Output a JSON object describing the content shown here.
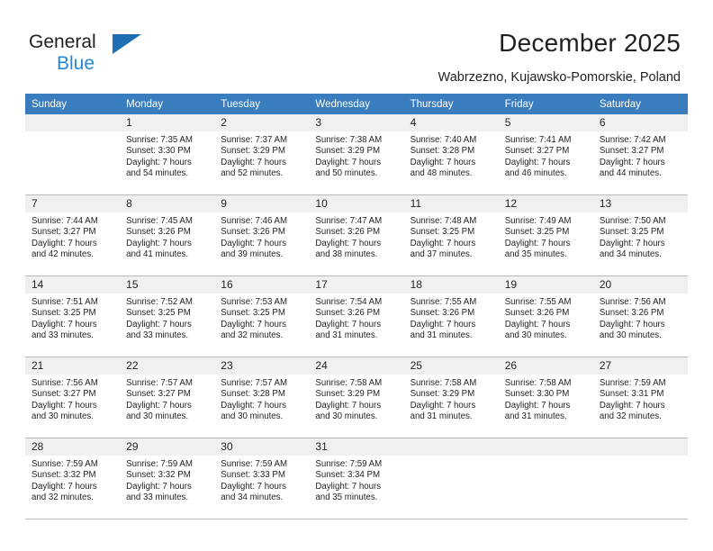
{
  "brand": {
    "name_part1": "General",
    "name_part2": "Blue",
    "triangle_color": "#1f6fb2",
    "blue_color": "#2389d4"
  },
  "header": {
    "title": "December 2025",
    "subtitle": "Wabrzezno, Kujawsko-Pomorskie, Poland"
  },
  "theme": {
    "header_row_bg": "#3a7dbe",
    "daynum_bg": "#f0f0f0",
    "border_color": "#b9b9b9",
    "text_color": "#231f20"
  },
  "weekdays": [
    "Sunday",
    "Monday",
    "Tuesday",
    "Wednesday",
    "Thursday",
    "Friday",
    "Saturday"
  ],
  "weeks": [
    [
      {
        "day": "",
        "lines": []
      },
      {
        "day": "1",
        "lines": [
          "Sunrise: 7:35 AM",
          "Sunset: 3:30 PM",
          "Daylight: 7 hours",
          "and 54 minutes."
        ]
      },
      {
        "day": "2",
        "lines": [
          "Sunrise: 7:37 AM",
          "Sunset: 3:29 PM",
          "Daylight: 7 hours",
          "and 52 minutes."
        ]
      },
      {
        "day": "3",
        "lines": [
          "Sunrise: 7:38 AM",
          "Sunset: 3:29 PM",
          "Daylight: 7 hours",
          "and 50 minutes."
        ]
      },
      {
        "day": "4",
        "lines": [
          "Sunrise: 7:40 AM",
          "Sunset: 3:28 PM",
          "Daylight: 7 hours",
          "and 48 minutes."
        ]
      },
      {
        "day": "5",
        "lines": [
          "Sunrise: 7:41 AM",
          "Sunset: 3:27 PM",
          "Daylight: 7 hours",
          "and 46 minutes."
        ]
      },
      {
        "day": "6",
        "lines": [
          "Sunrise: 7:42 AM",
          "Sunset: 3:27 PM",
          "Daylight: 7 hours",
          "and 44 minutes."
        ]
      }
    ],
    [
      {
        "day": "7",
        "lines": [
          "Sunrise: 7:44 AM",
          "Sunset: 3:27 PM",
          "Daylight: 7 hours",
          "and 42 minutes."
        ]
      },
      {
        "day": "8",
        "lines": [
          "Sunrise: 7:45 AM",
          "Sunset: 3:26 PM",
          "Daylight: 7 hours",
          "and 41 minutes."
        ]
      },
      {
        "day": "9",
        "lines": [
          "Sunrise: 7:46 AM",
          "Sunset: 3:26 PM",
          "Daylight: 7 hours",
          "and 39 minutes."
        ]
      },
      {
        "day": "10",
        "lines": [
          "Sunrise: 7:47 AM",
          "Sunset: 3:26 PM",
          "Daylight: 7 hours",
          "and 38 minutes."
        ]
      },
      {
        "day": "11",
        "lines": [
          "Sunrise: 7:48 AM",
          "Sunset: 3:25 PM",
          "Daylight: 7 hours",
          "and 37 minutes."
        ]
      },
      {
        "day": "12",
        "lines": [
          "Sunrise: 7:49 AM",
          "Sunset: 3:25 PM",
          "Daylight: 7 hours",
          "and 35 minutes."
        ]
      },
      {
        "day": "13",
        "lines": [
          "Sunrise: 7:50 AM",
          "Sunset: 3:25 PM",
          "Daylight: 7 hours",
          "and 34 minutes."
        ]
      }
    ],
    [
      {
        "day": "14",
        "lines": [
          "Sunrise: 7:51 AM",
          "Sunset: 3:25 PM",
          "Daylight: 7 hours",
          "and 33 minutes."
        ]
      },
      {
        "day": "15",
        "lines": [
          "Sunrise: 7:52 AM",
          "Sunset: 3:25 PM",
          "Daylight: 7 hours",
          "and 33 minutes."
        ]
      },
      {
        "day": "16",
        "lines": [
          "Sunrise: 7:53 AM",
          "Sunset: 3:25 PM",
          "Daylight: 7 hours",
          "and 32 minutes."
        ]
      },
      {
        "day": "17",
        "lines": [
          "Sunrise: 7:54 AM",
          "Sunset: 3:26 PM",
          "Daylight: 7 hours",
          "and 31 minutes."
        ]
      },
      {
        "day": "18",
        "lines": [
          "Sunrise: 7:55 AM",
          "Sunset: 3:26 PM",
          "Daylight: 7 hours",
          "and 31 minutes."
        ]
      },
      {
        "day": "19",
        "lines": [
          "Sunrise: 7:55 AM",
          "Sunset: 3:26 PM",
          "Daylight: 7 hours",
          "and 30 minutes."
        ]
      },
      {
        "day": "20",
        "lines": [
          "Sunrise: 7:56 AM",
          "Sunset: 3:26 PM",
          "Daylight: 7 hours",
          "and 30 minutes."
        ]
      }
    ],
    [
      {
        "day": "21",
        "lines": [
          "Sunrise: 7:56 AM",
          "Sunset: 3:27 PM",
          "Daylight: 7 hours",
          "and 30 minutes."
        ]
      },
      {
        "day": "22",
        "lines": [
          "Sunrise: 7:57 AM",
          "Sunset: 3:27 PM",
          "Daylight: 7 hours",
          "and 30 minutes."
        ]
      },
      {
        "day": "23",
        "lines": [
          "Sunrise: 7:57 AM",
          "Sunset: 3:28 PM",
          "Daylight: 7 hours",
          "and 30 minutes."
        ]
      },
      {
        "day": "24",
        "lines": [
          "Sunrise: 7:58 AM",
          "Sunset: 3:29 PM",
          "Daylight: 7 hours",
          "and 30 minutes."
        ]
      },
      {
        "day": "25",
        "lines": [
          "Sunrise: 7:58 AM",
          "Sunset: 3:29 PM",
          "Daylight: 7 hours",
          "and 31 minutes."
        ]
      },
      {
        "day": "26",
        "lines": [
          "Sunrise: 7:58 AM",
          "Sunset: 3:30 PM",
          "Daylight: 7 hours",
          "and 31 minutes."
        ]
      },
      {
        "day": "27",
        "lines": [
          "Sunrise: 7:59 AM",
          "Sunset: 3:31 PM",
          "Daylight: 7 hours",
          "and 32 minutes."
        ]
      }
    ],
    [
      {
        "day": "28",
        "lines": [
          "Sunrise: 7:59 AM",
          "Sunset: 3:32 PM",
          "Daylight: 7 hours",
          "and 32 minutes."
        ]
      },
      {
        "day": "29",
        "lines": [
          "Sunrise: 7:59 AM",
          "Sunset: 3:32 PM",
          "Daylight: 7 hours",
          "and 33 minutes."
        ]
      },
      {
        "day": "30",
        "lines": [
          "Sunrise: 7:59 AM",
          "Sunset: 3:33 PM",
          "Daylight: 7 hours",
          "and 34 minutes."
        ]
      },
      {
        "day": "31",
        "lines": [
          "Sunrise: 7:59 AM",
          "Sunset: 3:34 PM",
          "Daylight: 7 hours",
          "and 35 minutes."
        ]
      },
      {
        "day": "",
        "lines": []
      },
      {
        "day": "",
        "lines": []
      },
      {
        "day": "",
        "lines": []
      }
    ]
  ]
}
